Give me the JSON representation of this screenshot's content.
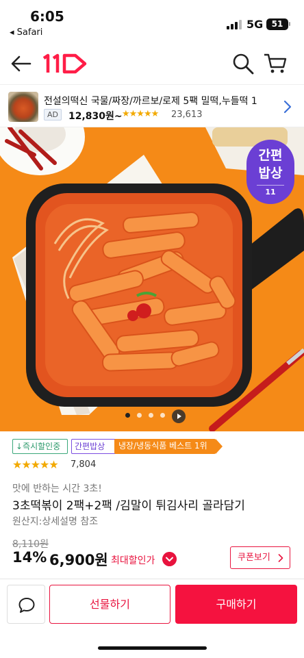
{
  "status_bar": {
    "time": "6:05",
    "back_app": "◂ Safari",
    "network": "5G",
    "battery": "51"
  },
  "header": {
    "logo": "11",
    "icons": [
      "back-arrow-icon",
      "logo-icon",
      "search-icon",
      "cart-icon"
    ]
  },
  "ad_banner": {
    "title": "전설의떡신 국물/짜장/까르보/로제 5팩  밀떡,누들떡 1",
    "badge": "AD",
    "price": "12,830원~",
    "stars": "★★★★★",
    "review_count": "23,613"
  },
  "hero": {
    "label_line1": "간편",
    "label_line2": "밥상",
    "label_mini": "11",
    "pager_total": 4,
    "pager_current": 1
  },
  "product": {
    "tags": [
      "↓즉시할인중",
      "간편밥상",
      "냉장/냉동식품 베스트 1위"
    ],
    "stars": "★★★★★",
    "rating_count": "7,804",
    "subtitle": "맛에 반하는 시간 3초!",
    "name": "3초떡볶이 2팩+2팩 /김말이 튀김사리 골라담기",
    "origin": "원산지:상세설명 참조",
    "original_price": "8,110원",
    "discount_rate": "14%",
    "price": "6,900원",
    "max_discount_label": "최대할인가",
    "coupon_label": "쿠폰보기"
  },
  "bottom_bar": {
    "gift_label": "선물하기",
    "buy_label": "구매하기"
  },
  "colors": {
    "brand_red": "#e8133e",
    "hero_orange": "#f58a17",
    "label_purple": "#6b3fd4",
    "star_yellow": "#f2a900"
  }
}
